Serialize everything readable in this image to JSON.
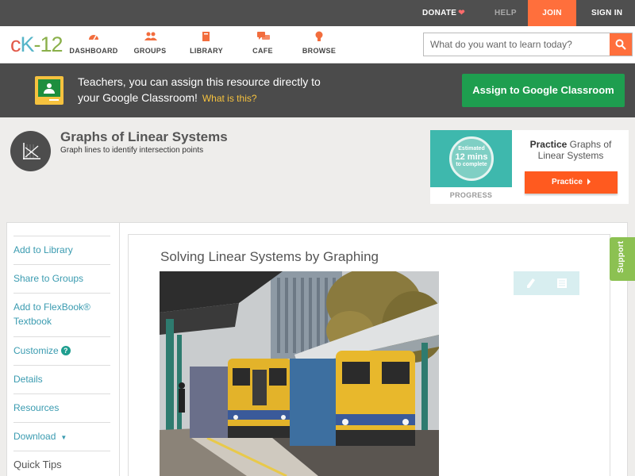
{
  "topbar": {
    "donate": "DONATE",
    "help": "HELP",
    "join": "JOIN",
    "signin": "SIGN IN"
  },
  "logo": {
    "c": "c",
    "k": "K",
    "n": "-12"
  },
  "nav": {
    "dashboard": "DASHBOARD",
    "groups": "GROUPS",
    "library": "LIBRARY",
    "cafe": "CAFE",
    "browse": "BROWSE"
  },
  "search": {
    "placeholder": "What do you want to learn today?"
  },
  "classroom": {
    "line1": "Teachers, you can assign this resource directly to",
    "line2": "your Google Classroom!",
    "what": "What is this?",
    "button": "Assign to Google Classroom"
  },
  "concept": {
    "title": "Graphs of Linear Systems",
    "subtitle": "Graph lines to identify intersection points"
  },
  "practice": {
    "ring_top": "Estimated",
    "ring_mid": "12 mins",
    "ring_bot": "to complete",
    "progress_label": "PROGRESS",
    "title_bold": "Practice",
    "title_rest": "Graphs of Linear Systems",
    "button": "Practice"
  },
  "sidebar": {
    "add_library": "Add to Library",
    "share_groups": "Share to Groups",
    "add_flexbook_1": "Add to FlexBook®",
    "add_flexbook_2": "Textbook",
    "customize": "Customize",
    "customize_help": "?",
    "details": "Details",
    "resources": "Resources",
    "download": "Download",
    "download_caret": "▼",
    "quick_tips": "Quick Tips"
  },
  "lesson": {
    "title": "Solving Linear Systems by Graphing"
  },
  "support": "Support",
  "colors": {
    "accent_orange": "#ff6f3c",
    "classroom_green": "#1e9e4f",
    "link_blue": "#3a9bb0",
    "support_green": "#8cc152"
  }
}
